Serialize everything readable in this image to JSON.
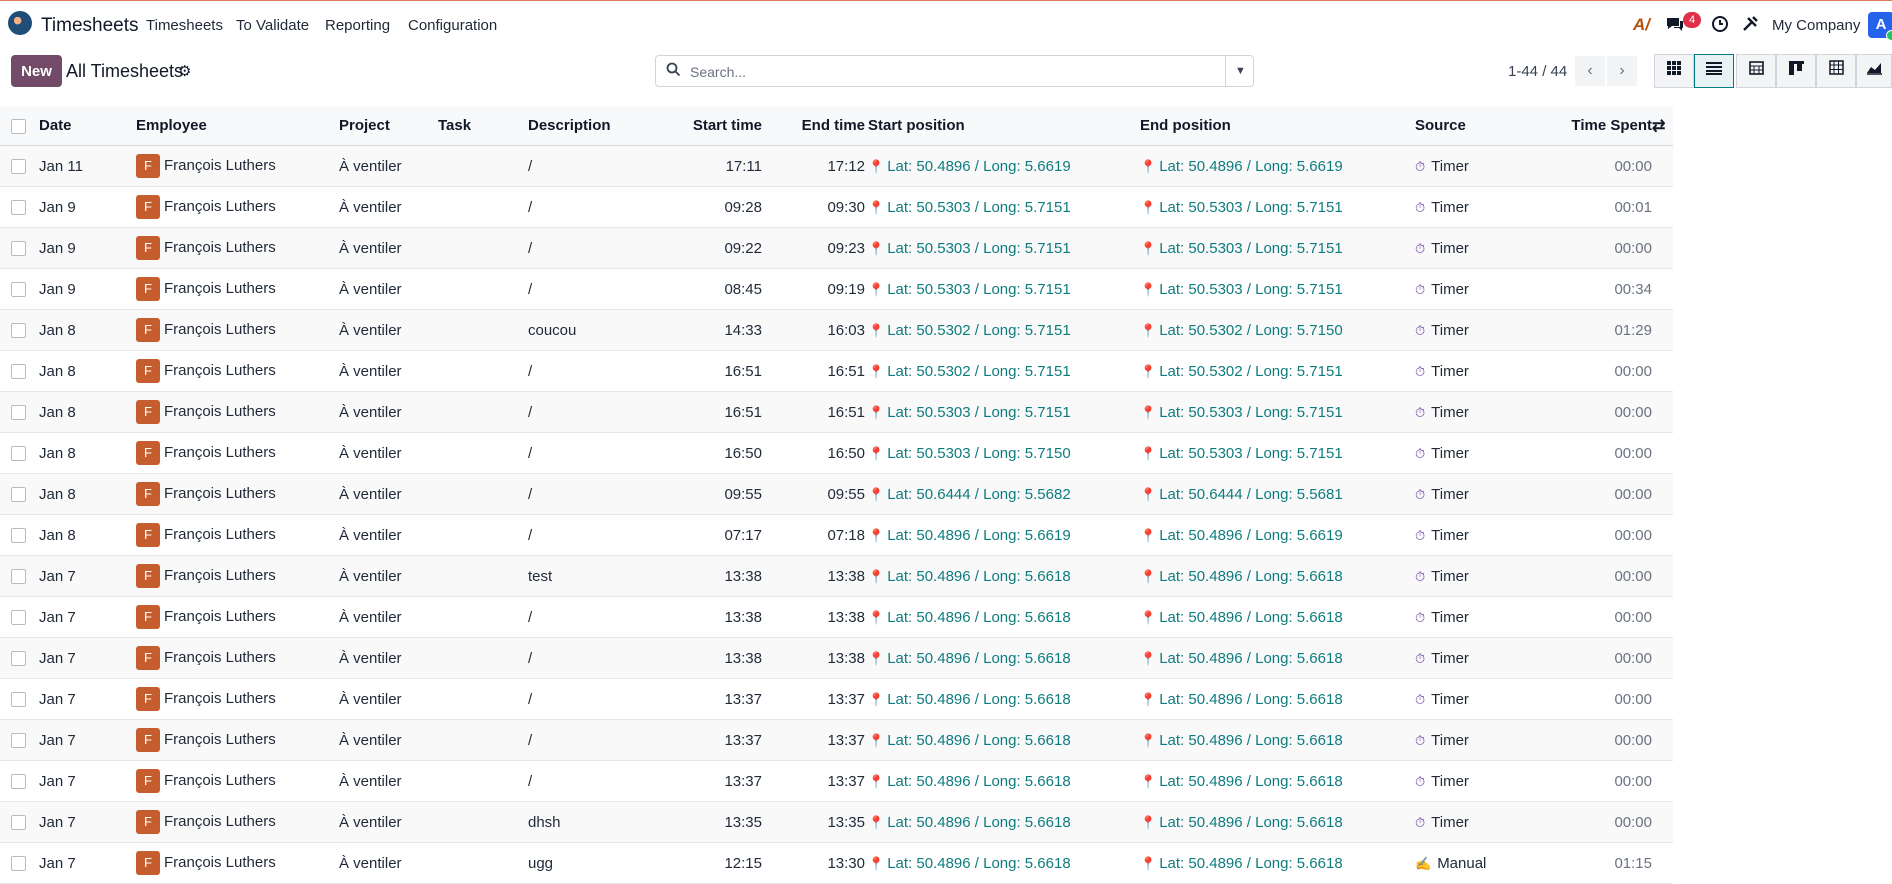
{
  "navbar": {
    "app_name": "Timesheets",
    "menus": [
      "Timesheets",
      "To Validate",
      "Reporting",
      "Configuration"
    ],
    "chat_badge": "4",
    "company": "My Company",
    "user_initial": "A",
    "icons": [
      "ai-icon",
      "chat-icon",
      "clock-icon",
      "tools-icon"
    ]
  },
  "control": {
    "new_label": "New",
    "breadcrumb": "All Timesheets",
    "search_placeholder": "Search...",
    "pager": "1-44 / 44",
    "views": [
      "grid-view",
      "list-view",
      "calendar-view",
      "kanban-view",
      "pivot-view",
      "graph-view"
    ],
    "active_view": "list-view"
  },
  "table": {
    "headers": {
      "date": "Date",
      "employee": "Employee",
      "project": "Project",
      "task": "Task",
      "description": "Description",
      "start_time": "Start time",
      "end_time": "End time",
      "start_position": "Start position",
      "end_position": "End position",
      "source": "Source",
      "time_spent": "Time Spent"
    },
    "rows": [
      {
        "date": "Jan 11",
        "employee": "François Luthers",
        "initial": "F",
        "project": "À ventiler",
        "task": "",
        "description": "/",
        "start": "17:11",
        "end": "17:12",
        "start_pos": "Lat: 50.4896 / Long: 5.6619",
        "end_pos": "Lat: 50.4896 / Long: 5.6619",
        "source": "Timer",
        "spent": "00:00"
      },
      {
        "date": "Jan 9",
        "employee": "François Luthers",
        "initial": "F",
        "project": "À ventiler",
        "task": "",
        "description": "/",
        "start": "09:28",
        "end": "09:30",
        "start_pos": "Lat: 50.5303 / Long: 5.7151",
        "end_pos": "Lat: 50.5303 / Long: 5.7151",
        "source": "Timer",
        "spent": "00:01"
      },
      {
        "date": "Jan 9",
        "employee": "François Luthers",
        "initial": "F",
        "project": "À ventiler",
        "task": "",
        "description": "/",
        "start": "09:22",
        "end": "09:23",
        "start_pos": "Lat: 50.5303 / Long: 5.7151",
        "end_pos": "Lat: 50.5303 / Long: 5.7151",
        "source": "Timer",
        "spent": "00:00"
      },
      {
        "date": "Jan 9",
        "employee": "François Luthers",
        "initial": "F",
        "project": "À ventiler",
        "task": "",
        "description": "/",
        "start": "08:45",
        "end": "09:19",
        "start_pos": "Lat: 50.5303 / Long: 5.7151",
        "end_pos": "Lat: 50.5303 / Long: 5.7151",
        "source": "Timer",
        "spent": "00:34"
      },
      {
        "date": "Jan 8",
        "employee": "François Luthers",
        "initial": "F",
        "project": "À ventiler",
        "task": "",
        "description": "coucou",
        "start": "14:33",
        "end": "16:03",
        "start_pos": "Lat: 50.5302 / Long: 5.7151",
        "end_pos": "Lat: 50.5302 / Long: 5.7150",
        "source": "Timer",
        "spent": "01:29"
      },
      {
        "date": "Jan 8",
        "employee": "François Luthers",
        "initial": "F",
        "project": "À ventiler",
        "task": "",
        "description": "/",
        "start": "16:51",
        "end": "16:51",
        "start_pos": "Lat: 50.5302 / Long: 5.7151",
        "end_pos": "Lat: 50.5302 / Long: 5.7151",
        "source": "Timer",
        "spent": "00:00"
      },
      {
        "date": "Jan 8",
        "employee": "François Luthers",
        "initial": "F",
        "project": "À ventiler",
        "task": "",
        "description": "/",
        "start": "16:51",
        "end": "16:51",
        "start_pos": "Lat: 50.5303 / Long: 5.7151",
        "end_pos": "Lat: 50.5303 / Long: 5.7151",
        "source": "Timer",
        "spent": "00:00"
      },
      {
        "date": "Jan 8",
        "employee": "François Luthers",
        "initial": "F",
        "project": "À ventiler",
        "task": "",
        "description": "/",
        "start": "16:50",
        "end": "16:50",
        "start_pos": "Lat: 50.5303 / Long: 5.7150",
        "end_pos": "Lat: 50.5303 / Long: 5.7151",
        "source": "Timer",
        "spent": "00:00"
      },
      {
        "date": "Jan 8",
        "employee": "François Luthers",
        "initial": "F",
        "project": "À ventiler",
        "task": "",
        "description": "/",
        "start": "09:55",
        "end": "09:55",
        "start_pos": "Lat: 50.6444 / Long: 5.5682",
        "end_pos": "Lat: 50.6444 / Long: 5.5681",
        "source": "Timer",
        "spent": "00:00"
      },
      {
        "date": "Jan 8",
        "employee": "François Luthers",
        "initial": "F",
        "project": "À ventiler",
        "task": "",
        "description": "/",
        "start": "07:17",
        "end": "07:18",
        "start_pos": "Lat: 50.4896 / Long: 5.6619",
        "end_pos": "Lat: 50.4896 / Long: 5.6619",
        "source": "Timer",
        "spent": "00:00"
      },
      {
        "date": "Jan 7",
        "employee": "François Luthers",
        "initial": "F",
        "project": "À ventiler",
        "task": "",
        "description": "test",
        "start": "13:38",
        "end": "13:38",
        "start_pos": "Lat: 50.4896 / Long: 5.6618",
        "end_pos": "Lat: 50.4896 / Long: 5.6618",
        "source": "Timer",
        "spent": "00:00"
      },
      {
        "date": "Jan 7",
        "employee": "François Luthers",
        "initial": "F",
        "project": "À ventiler",
        "task": "",
        "description": "/",
        "start": "13:38",
        "end": "13:38",
        "start_pos": "Lat: 50.4896 / Long: 5.6618",
        "end_pos": "Lat: 50.4896 / Long: 5.6618",
        "source": "Timer",
        "spent": "00:00"
      },
      {
        "date": "Jan 7",
        "employee": "François Luthers",
        "initial": "F",
        "project": "À ventiler",
        "task": "",
        "description": "/",
        "start": "13:38",
        "end": "13:38",
        "start_pos": "Lat: 50.4896 / Long: 5.6618",
        "end_pos": "Lat: 50.4896 / Long: 5.6618",
        "source": "Timer",
        "spent": "00:00"
      },
      {
        "date": "Jan 7",
        "employee": "François Luthers",
        "initial": "F",
        "project": "À ventiler",
        "task": "",
        "description": "/",
        "start": "13:37",
        "end": "13:37",
        "start_pos": "Lat: 50.4896 / Long: 5.6618",
        "end_pos": "Lat: 50.4896 / Long: 5.6618",
        "source": "Timer",
        "spent": "00:00"
      },
      {
        "date": "Jan 7",
        "employee": "François Luthers",
        "initial": "F",
        "project": "À ventiler",
        "task": "",
        "description": "/",
        "start": "13:37",
        "end": "13:37",
        "start_pos": "Lat: 50.4896 / Long: 5.6618",
        "end_pos": "Lat: 50.4896 / Long: 5.6618",
        "source": "Timer",
        "spent": "00:00"
      },
      {
        "date": "Jan 7",
        "employee": "François Luthers",
        "initial": "F",
        "project": "À ventiler",
        "task": "",
        "description": "/",
        "start": "13:37",
        "end": "13:37",
        "start_pos": "Lat: 50.4896 / Long: 5.6618",
        "end_pos": "Lat: 50.4896 / Long: 5.6618",
        "source": "Timer",
        "spent": "00:00"
      },
      {
        "date": "Jan 7",
        "employee": "François Luthers",
        "initial": "F",
        "project": "À ventiler",
        "task": "",
        "description": "dhsh",
        "start": "13:35",
        "end": "13:35",
        "start_pos": "Lat: 50.4896 / Long: 5.6618",
        "end_pos": "Lat: 50.4896 / Long: 5.6618",
        "source": "Timer",
        "spent": "00:00"
      },
      {
        "date": "Jan 7",
        "employee": "François Luthers",
        "initial": "F",
        "project": "À ventiler",
        "task": "",
        "description": "ugg",
        "start": "12:15",
        "end": "13:30",
        "start_pos": "Lat: 50.4896 / Long: 5.6618",
        "end_pos": "Lat: 50.4896 / Long: 5.6618",
        "source": "Manual",
        "spent": "01:15"
      }
    ]
  },
  "colors": {
    "brand": "#714b67",
    "accent": "#017e84",
    "geo_link": "#0e7c7e",
    "avatar": "#c65d2e",
    "badge": "#e0314b"
  }
}
